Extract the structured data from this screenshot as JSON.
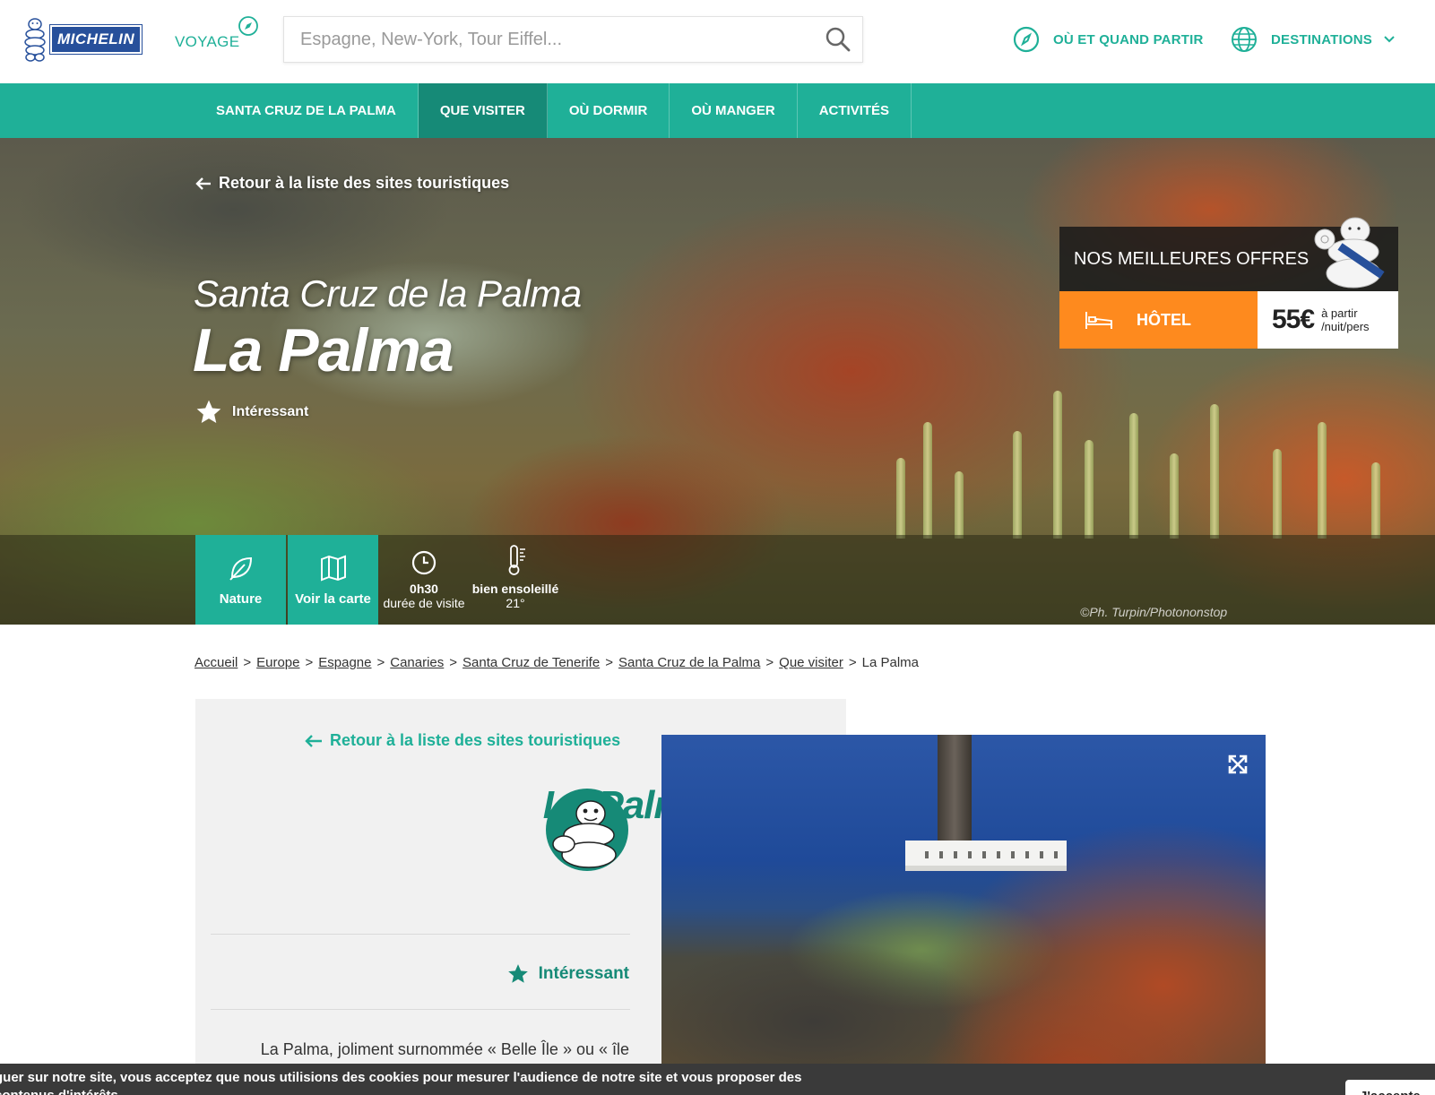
{
  "header": {
    "logo_text": "MICHELIN",
    "voyage_label": "VOYAGE",
    "search_placeholder": "Espagne, New-York, Tour Eiffel...",
    "when_label": "OÙ ET QUAND PARTIR",
    "destinations_label": "DESTINATIONS"
  },
  "nav": {
    "items": [
      {
        "label": "SANTA CRUZ DE LA PALMA",
        "active": false
      },
      {
        "label": "QUE VISITER",
        "active": true
      },
      {
        "label": "OÙ DORMIR",
        "active": false
      },
      {
        "label": "OÙ MANGER",
        "active": false
      },
      {
        "label": "ACTIVITÉS",
        "active": false
      }
    ]
  },
  "hero": {
    "back_label": "Retour à la liste des sites touristiques",
    "subtitle": "Santa Cruz de la Palma",
    "title": "La Palma",
    "rating_label": "Intéressant",
    "tiles": {
      "nature_label": "Nature",
      "map_label": "Voir la carte"
    },
    "duration": {
      "value": "0h30",
      "label": "durée de visite"
    },
    "weather": {
      "label": "bien ensoleillé",
      "temp": "21°"
    },
    "credit": "©Ph. Turpin/Photononstop",
    "offers": {
      "title": "NOS MEILLEURES OFFRES",
      "hotel_label": "HÔTEL",
      "price": "55€",
      "price_note_1": "à partir",
      "price_note_2": "/nuit/pers"
    }
  },
  "breadcrumb": {
    "links": [
      "Accueil",
      "Europe",
      "Espagne",
      "Canaries",
      "Santa Cruz de Tenerife",
      "Santa Cruz de la Palma",
      "Que visiter"
    ],
    "current": "La Palma",
    "separator": ">"
  },
  "card": {
    "back_label": "Retour à la liste des sites touristiques",
    "title": "La Palma",
    "rating_label": "Intéressant",
    "description": "La Palma, joliment surnommée « Belle Île » ou « île"
  },
  "cookie": {
    "text": "guer sur notre site, vous acceptez que nous utilisions des cookies pour mesurer l'audience de notre site et vous proposer des contenus d'intérêts",
    "accept_label": "J'accepte"
  },
  "colors": {
    "brand_green": "#1fb098",
    "dark_green": "#168a77",
    "offer_orange": "#fe8a1e",
    "michelin_blue": "#27509b"
  }
}
